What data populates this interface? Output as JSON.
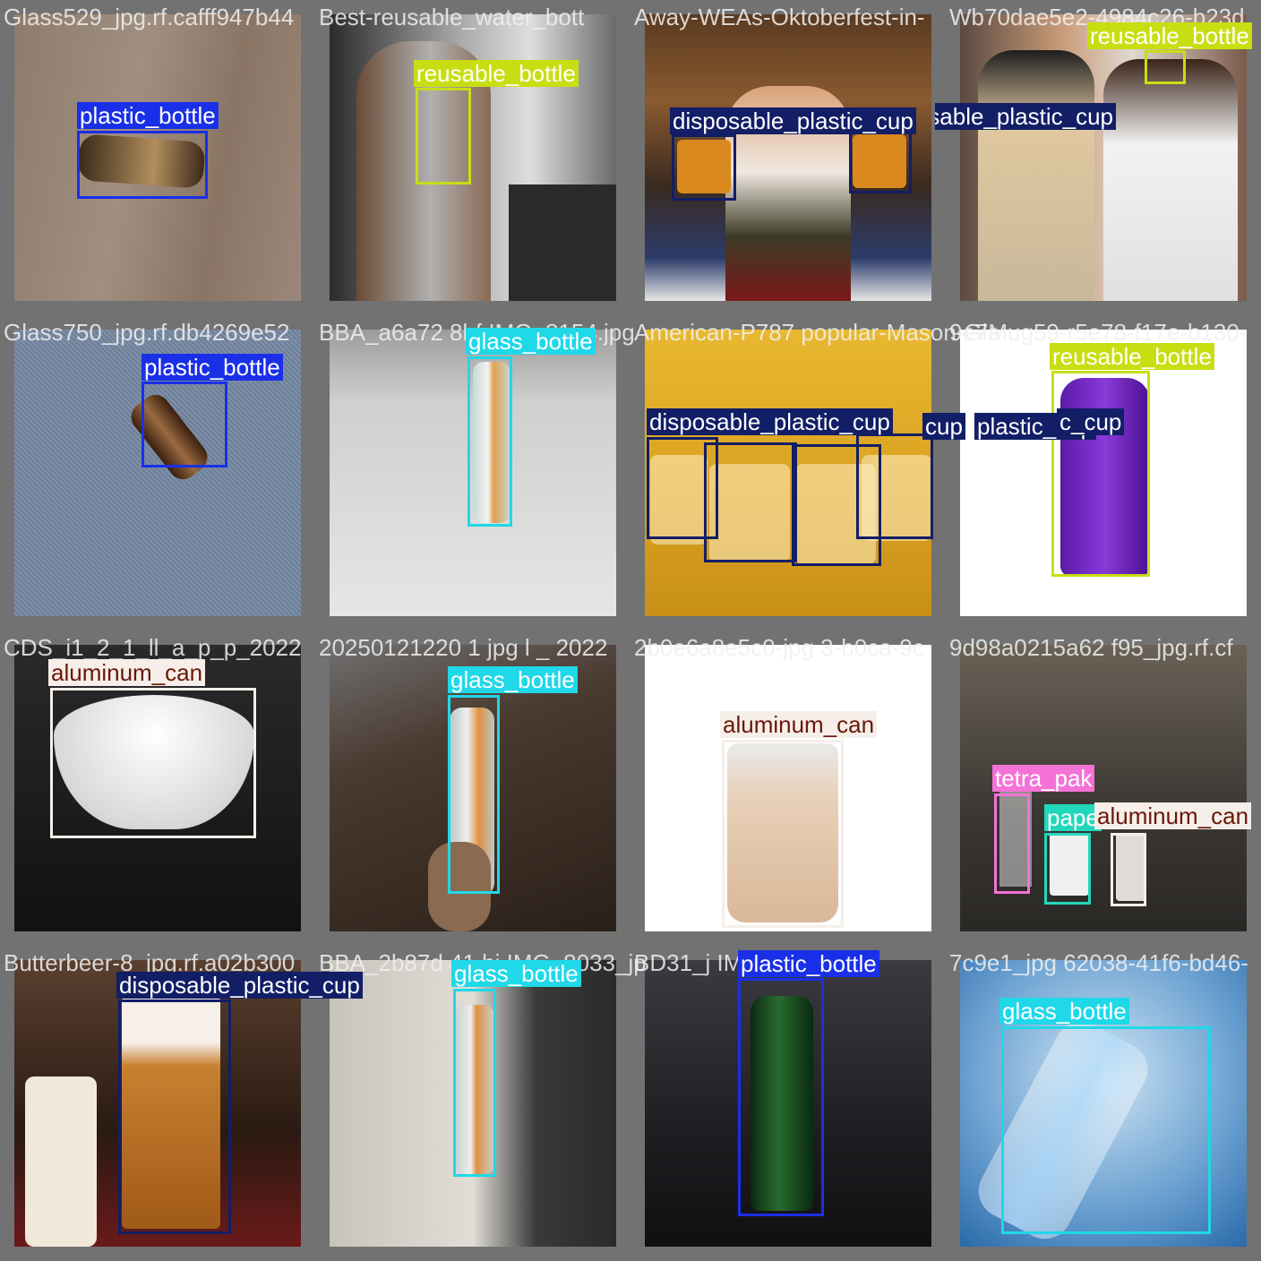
{
  "colors": {
    "plastic_bottle": "#1a2fe8",
    "reusable_bottle": "#c8de12",
    "disposable_plastic_cup": "#121e66",
    "glass_bottle": "#1fd8e8",
    "aluminum_can": "#f6efe9",
    "tetra_pak": "#f472d6",
    "paper_cup": "#22d8bc"
  },
  "label_text_colors": {
    "plastic_bottle": "#ffffff",
    "reusable_bottle": "#ffffff",
    "disposable_plastic_cup": "#ffffff",
    "glass_bottle": "#ffffff",
    "aluminum_can": "#6b1608",
    "tetra_pak": "#ffffff",
    "paper_cup": "#ffffff"
  },
  "cells": [
    {
      "title": "Glass529_jpg.rf.cafff947b44",
      "scene": "wood",
      "boxes": [
        {
          "cls": "plastic_bottle",
          "label": "plastic_bottle"
        }
      ]
    },
    {
      "title": "Best-reusable_water_bott",
      "scene": "gym",
      "boxes": [
        {
          "cls": "reusable_bottle",
          "label": "reusable_bottle"
        }
      ]
    },
    {
      "title": "Away-WEAs-Oktoberfest-in-",
      "scene": "beer",
      "boxes": [
        {
          "cls": "disposable_plastic_cup",
          "label": "disposable_plastic_cup"
        },
        {
          "cls": "disposable_plastic_cup",
          "label": "disposable_plastic_cup"
        }
      ]
    },
    {
      "title": "Wb70dae5e2-4984c26-b23d",
      "scene": "girls",
      "boxes": [
        {
          "cls": "reusable_bottle",
          "label": "reusable_bottle"
        }
      ]
    },
    {
      "title": "Glass750_jpg.rf.db4269e52",
      "scene": "carpet",
      "boxes": [
        {
          "cls": "plastic_bottle",
          "label": "plastic_bottle"
        }
      ]
    },
    {
      "title": "BBA_a6a72 8bf IMG_8154.jpg",
      "scene": "floor",
      "boxes": [
        {
          "cls": "glass_bottle",
          "label": "glass_bottle"
        }
      ]
    },
    {
      "title": "American-P787 popular-Mason-Gla",
      "scene": "mason",
      "boxes": [
        {
          "cls": "disposable_plastic_cup",
          "label": "disposable_plastic_cup"
        },
        {
          "cls": "disposable_plastic_cup",
          "label": "cup"
        },
        {
          "cls": "disposable_plastic_cup",
          "label": "plastic_cup"
        },
        {
          "cls": "disposable_plastic_cup",
          "label": "c_cup"
        }
      ]
    },
    {
      "title": "9e7Mug59-r5e78-f17e-b130-",
      "scene": "purple",
      "boxes": [
        {
          "cls": "reusable_bottle",
          "label": "reusable_bottle"
        }
      ]
    },
    {
      "title": "CDS_i1_2_1_ll_a_p_p_2022",
      "scene": "bowl",
      "boxes": [
        {
          "cls": "aluminum_can",
          "label": "aluminum_can"
        }
      ]
    },
    {
      "title": "20250121220 1 jpg l _ 2022",
      "scene": "table",
      "boxes": [
        {
          "cls": "glass_bottle",
          "label": "glass_bottle"
        }
      ]
    },
    {
      "title": "2b0e6a8e5c0-jpg 3-b0ca-9c",
      "scene": "milkshake",
      "boxes": [
        {
          "cls": "aluminum_can",
          "label": "aluminum_can"
        }
      ]
    },
    {
      "title": "9d98a0215a62 f95_jpg.rf.cf",
      "scene": "cups",
      "boxes": [
        {
          "cls": "tetra_pak",
          "label": "tetra_pak"
        },
        {
          "cls": "paper_cup",
          "label": "pape"
        },
        {
          "cls": "aluminum_can",
          "label": "aluminum_can"
        }
      ]
    },
    {
      "title": "Butterbeer-8_jpg.rf.a02b300",
      "scene": "butterbeer",
      "boxes": [
        {
          "cls": "disposable_plastic_cup",
          "label": "disposable_plastic_cup"
        }
      ]
    },
    {
      "title": "BBA_2b87d 41 bi IMG_8033_jp",
      "scene": "marble",
      "boxes": [
        {
          "cls": "glass_bottle",
          "label": "glass_bottle"
        }
      ]
    },
    {
      "title": "BD31_j IMG_7999.jpg",
      "scene": "green",
      "boxes": [
        {
          "cls": "plastic_bottle",
          "label": "plastic_bottle"
        }
      ]
    },
    {
      "title": "7c9e1_jpg 62038-41f6-bd46-",
      "scene": "water",
      "boxes": [
        {
          "cls": "glass_bottle",
          "label": "glass_bottle"
        }
      ]
    }
  ]
}
